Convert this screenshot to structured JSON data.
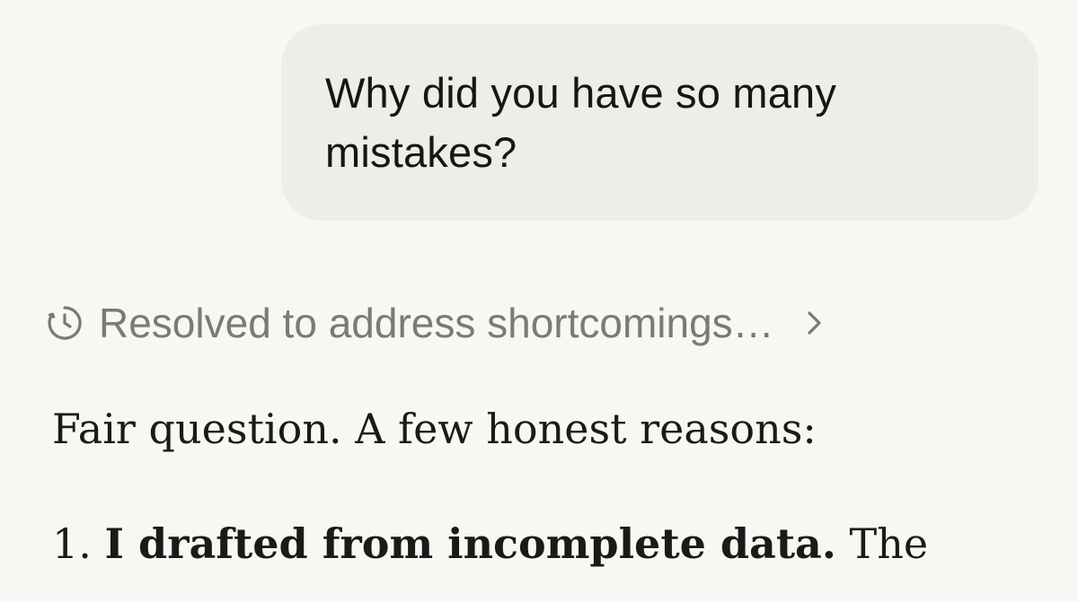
{
  "user_message": {
    "text": "Why did you have so many mistakes?"
  },
  "thinking": {
    "icon": "clock-icon",
    "summary": "Resolved to address shortcomings…",
    "expand_icon": "chevron-right-icon"
  },
  "assistant_message": {
    "intro": "Fair question. A few honest reasons:",
    "list_item_1": {
      "number": "1.",
      "bold_text": "I drafted from incomplete data.",
      "text": "The"
    }
  },
  "colors": {
    "background": "#f8f7f3",
    "user_bubble": "#efede7",
    "muted_text": "#7b7a75",
    "body_text": "#1a1a18"
  }
}
